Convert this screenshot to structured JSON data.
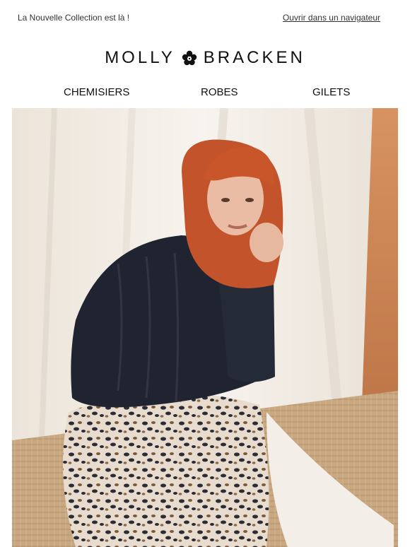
{
  "header": {
    "preheader_text": "La Nouvelle Collection est là !",
    "view_in_browser_label": "Ouvrir dans un navigateur"
  },
  "brand": {
    "logo_left": "MOLLY",
    "logo_right": "BRACKEN",
    "logo_mark_icon": "clover-flower-icon"
  },
  "nav": {
    "items": [
      {
        "label": "CHEMISIERS"
      },
      {
        "label": "ROBES"
      },
      {
        "label": "GILETS"
      }
    ]
  },
  "hero": {
    "image_subject": "model-photo",
    "colors": {
      "curtain": "#f3eee7",
      "wall": "#c07a4a",
      "sweater": "#1f2430",
      "hair": "#c9562a",
      "skin": "#e7b8a0",
      "skirt_base": "#e9dfd1",
      "skirt_spots": "#2b2c35",
      "rug": "#c9a881"
    }
  }
}
